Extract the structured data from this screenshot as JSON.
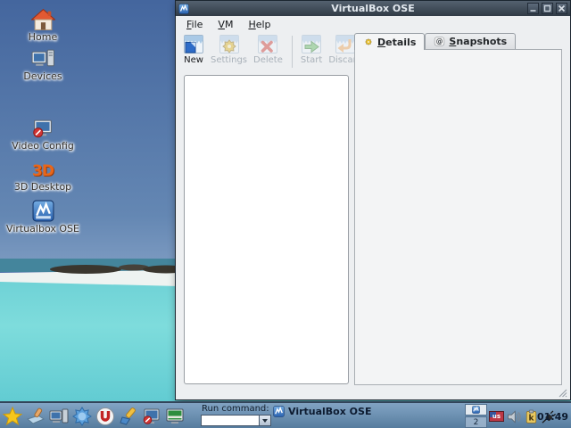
{
  "desktop": {
    "icons": [
      {
        "label": "Home"
      },
      {
        "label": "Devices"
      },
      {
        "label": "Video Config"
      },
      {
        "label": "3D Desktop",
        "icon_text": "3D"
      },
      {
        "label": "Virtualbox OSE"
      }
    ]
  },
  "window": {
    "title": "VirtualBox OSE",
    "menu": {
      "file": "File",
      "vm": "VM",
      "help": "Help"
    },
    "toolbar": {
      "new": "New",
      "settings": "Settings",
      "delete": "Delete",
      "start": "Start",
      "discard": "Discard"
    },
    "tabs": {
      "details": "Details",
      "snapshots": "Snapshots",
      "snapshots_icon_glyph": "@"
    }
  },
  "taskbar": {
    "run_label": "Run command:",
    "run_value": "",
    "task_button_label": "VirtualBox OSE",
    "pager_workspace_label": "2",
    "tray": {
      "keyboard_layout": "us",
      "klipper_letter": "k",
      "clock": "01:49"
    }
  },
  "colors": {
    "titlebar_top": "#54616f",
    "titlebar_bottom": "#313b46",
    "window_bg": "#edeff1",
    "taskbar_blue": "#7b9cc0",
    "water_turquoise": "#7edcdc",
    "sky_blue": "#44669e",
    "vbox_icon_blue": "#2e6ec4"
  }
}
